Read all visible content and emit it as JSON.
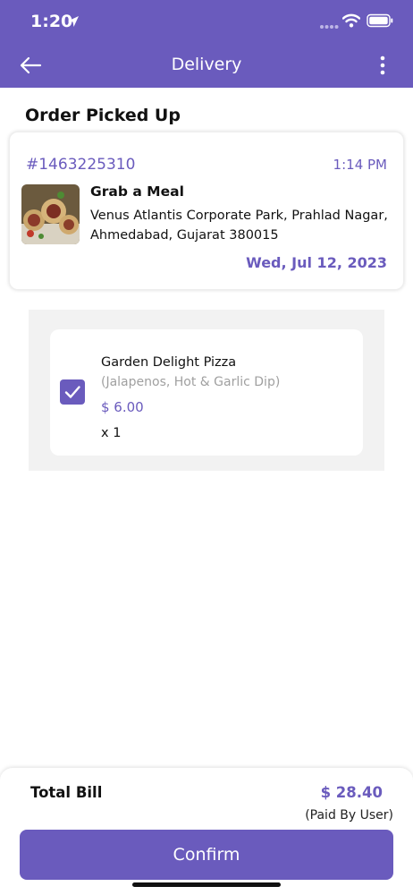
{
  "status_bar": {
    "time": "1:20"
  },
  "nav": {
    "title": "Delivery"
  },
  "section_title": "Order Picked Up",
  "order": {
    "id": "#1463225310",
    "time": "1:14 PM",
    "store_name": "Grab a Meal",
    "address": "Venus Atlantis Corporate Park, Prahlad Nagar, Ahmedabad, Gujarat 380015",
    "date": "Wed, Jul 12, 2023"
  },
  "items": [
    {
      "name": "Garden Delight Pizza",
      "options": "(Jalapenos, Hot & Garlic Dip)",
      "price": "$ 6.00",
      "quantity": "x 1",
      "checked": true
    }
  ],
  "bill": {
    "label": "Total Bill",
    "value": "$ 28.40",
    "paid_by": "(Paid By User)"
  },
  "confirm_label": "Confirm",
  "colors": {
    "primary": "#6a5bbd",
    "panel": "#f2f2f2",
    "muted": "#a0a0a0"
  },
  "icons": [
    "location-arrow-icon",
    "signal-icon",
    "wifi-icon",
    "battery-icon",
    "back-arrow-icon",
    "more-vertical-icon",
    "checkmark-icon"
  ]
}
